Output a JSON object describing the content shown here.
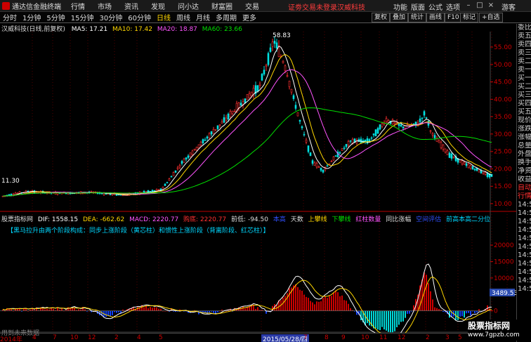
{
  "app": {
    "title": "通达信金融终端",
    "notice": "证劵交易未登录",
    "stock_name_top": "汉威科技"
  },
  "menu": [
    "行情",
    "市场",
    "资讯",
    "发现",
    "问小达",
    "财富圈",
    "交易"
  ],
  "right_menu": [
    "功能",
    "版面",
    "公式",
    "选项",
    "游客"
  ],
  "periods": [
    "分时",
    "1分钟",
    "5分钟",
    "15分钟",
    "30分钟",
    "60分钟",
    "日线",
    "周线",
    "月线",
    "多周期",
    "更多"
  ],
  "active_period": "日线",
  "tools": [
    "复权",
    "叠加",
    "统计",
    "画线",
    "F10",
    "标记",
    "+自选"
  ],
  "main_title": "汉威科技(日线,前复权)",
  "ma": {
    "ma5": "MA5: 17.21",
    "ma10": "MA10: 17.42",
    "ma20": "MA20: 18.87",
    "ma60": "MA60: 23.66"
  },
  "indicator": {
    "name": "股票指标网",
    "dif": "DIF: 1558.15",
    "dea": "DEA: -662.62",
    "macd": "MACD: 2220.77",
    "buy": "购底: 2220.77",
    "front_low": "前低: -94.50",
    "labels": [
      "本高",
      "天数",
      "上攀线",
      "下攀线",
      "红柱数量",
      "同比涨幅",
      "空间评估",
      "前高本高二分位"
    ],
    "hint": "【黑马拉升由两个阶段构成：同步上涨阶段（黄芯柱）和惯性上涨阶段（背离阶段、红芯柱）】"
  },
  "price_axis": [
    "55.00",
    "50.00",
    "45.00",
    "40.00",
    "35.00",
    "30.00",
    "25.00",
    "20.00",
    "15.00",
    "10.00"
  ],
  "peak_label": "58.83",
  "low_label": "11.30",
  "ind_axis": [
    "20000",
    "15000",
    "10000",
    "5000",
    "0",
    "-5000"
  ],
  "ind_current": "3489.53",
  "right_panel": [
    "委比",
    "卖五",
    "卖四",
    "卖三",
    "卖二",
    "卖一",
    "买一",
    "买二",
    "买三",
    "买四",
    "买五",
    "现价",
    "涨跌",
    "涨幅",
    "总量",
    "外盘",
    "换手",
    "净资",
    "收益",
    "自动",
    "行情",
    "14:50",
    "14:50",
    "14:50",
    "14:50",
    "14:50",
    "14:50",
    "14:50",
    "14:50",
    "14:50",
    "14:50",
    "14:50"
  ],
  "dates": [
    "2014年",
    "4",
    "7",
    "10",
    "12",
    "2",
    "4",
    "5",
    "2015/05/28/四",
    "7",
    "8",
    "9",
    "10",
    "11",
    "12",
    "2",
    "3",
    "5",
    "6",
    "8",
    "9"
  ],
  "no_data": "用到未来数据",
  "watermark": {
    "line1": "股票指标网",
    "line2": "www.7gpzb.com"
  },
  "colors": {
    "ma5": "#ffffff",
    "ma10": "#ffd700",
    "ma20": "#ff55ff",
    "ma60": "#00e000",
    "up": "#ff3030",
    "down": "#00e0e0"
  }
}
